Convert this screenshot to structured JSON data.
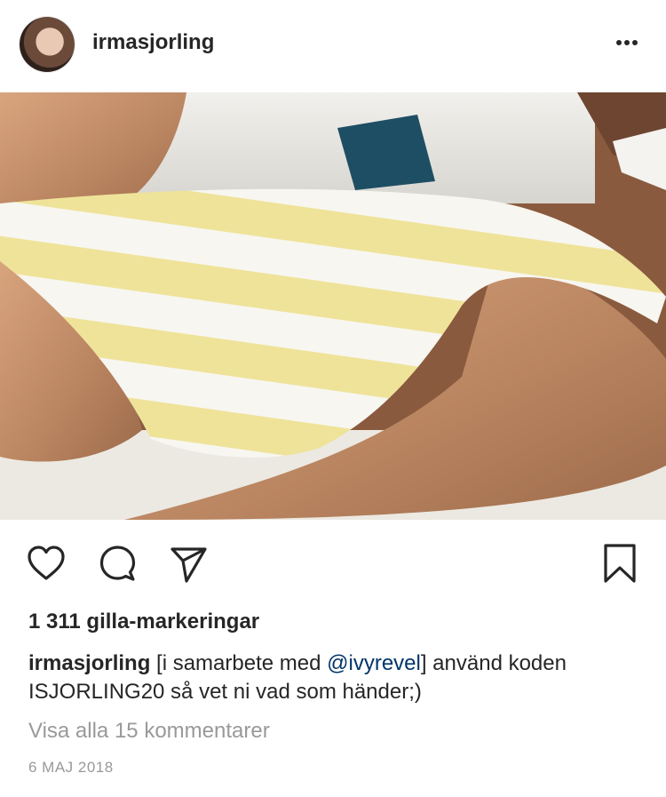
{
  "post": {
    "username": "irmasjorling",
    "avatar_icon": "avatar-image",
    "more_icon": "more-options-icon",
    "likes_text": "1 311 gilla-markeringar",
    "caption": {
      "username": "irmasjorling",
      "text_before": " [i samarbete med ",
      "mention": "@ivyrevel",
      "text_after": "] använd koden ISJORLING20 så vet ni vad som händer;)"
    },
    "view_comments": "Visa alla 15 kommentarer",
    "date": "6 MAJ 2018"
  },
  "actions": {
    "like_icon": "heart-icon",
    "comment_icon": "comment-icon",
    "share_icon": "paper-plane-icon",
    "save_icon": "bookmark-icon"
  },
  "colors": {
    "text": "#262626",
    "secondary": "#999999",
    "mention": "#003569",
    "stripe_yellow": "#efe39a",
    "stripe_white": "#f7f6f0"
  }
}
